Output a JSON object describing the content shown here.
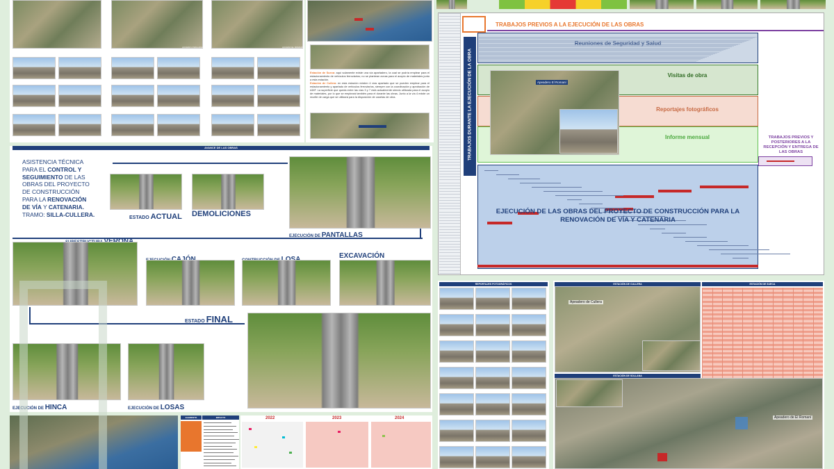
{
  "colors": {
    "navy": "#1f3f7a",
    "orange": "#e8762d",
    "red": "#c62828",
    "green_band": "#dfeedd",
    "salmon": "#f4b6a8",
    "violet": "#7b3fa0"
  },
  "sketch": {
    "title_bar": "AVANCE DE LAS OBRAS",
    "intro": {
      "line1": "ASISTENCIA TÉCNICA",
      "line2a": "PARA EL ",
      "line2b": "CONTROL Y",
      "line3": "SEGUIMIENTO",
      "line3b": " DE LAS",
      "line4": "OBRAS DEL PROYECTO",
      "line5": "DE CONSTRUCCIÓN",
      "line6a": "PARA LA ",
      "line6b": "RENOVACIÓN",
      "line7a": "DE VÍA",
      "line7b": " Y ",
      "line7c": "CATENARIA.",
      "line8a": "TRAMO: ",
      "line8b": "SILLA-CULLERA."
    },
    "labels": {
      "estado_small": "ESTADO ",
      "estado_big": "ACTUAL",
      "demoliciones": "DEMOLICIONES",
      "pantallas_small": "EJECUCIÓN DE ",
      "pantallas_big": "PANTALLAS",
      "verona_small": "SUBESTRUCTURA ",
      "verona_big": "VERONA",
      "cajon_small": "EJECUCIÓN ",
      "cajon_big": "CAJÓN",
      "losa_small": "CONTRUCCIÓN DE ",
      "losa_big": "LOSA",
      "excavacion": "EXCAVACIÓN",
      "final_small": "ESTADO ",
      "final_big": "FINAL",
      "hinca_small": "EJECUCIÓN DE ",
      "hinca_big": "HINCA",
      "losas_small": "EJECUCIÓN DE ",
      "losas_big": "LOSAS"
    }
  },
  "gantt": {
    "header": "TRABAJOS PREVIOS A LA EJECUCIÓN DE LAS OBRAS",
    "vertical_label": "TRABAJOS DURANTE LA EJECUCIÓN DE LA OBRA",
    "bands": {
      "seguridad": "Reuniones de Seguridad y Salud",
      "visitas": "Visitas de obra",
      "reportajes": "Reportajes fotográficos",
      "informe": "Informe mensual"
    },
    "side_label": "TRABAJOS PREVIOS Y POSTERIORES A LA RECEPCIÓN Y ENTREGA DE LAS OBRAS",
    "execution": "EJECUCIÓN DE LAS OBRAS DEL PROYECTO DE CONSTRUCCIÓN PARA LA RENOVACIÓN DE VÍA Y CATENARIA",
    "inset_caption": "Apeadero El Romaní"
  },
  "station_text": {
    "p1a": "Estación de Sueca",
    "p1b": ": aquí solamente existe una vía apartadero, la cual se podría emplear para el estacionamiento de vehículos ferroviarios; no se plantean zonas para el acopio de materiales junto a esta estación.",
    "p2a": "Estación de Cullera",
    "p2b": ": en esta estación existen 4 vías apartado que se pueden emplear para el estacionamiento y apartado de vehículos ferroviarios, siempre con la coordinación y aprobación de ADIF. La superficie que queda entre las vías 3 y 7 está actualmente siendo utilizada para el acopio de materiales, por lo que se empleará también para el durante las obras. Junto a la vía 4 existe un muelle de carga que se utilizará para la disposición de casetas de obra."
  },
  "reportaje": {
    "title": "REPORTAJES FOTOGRÁFICOS"
  },
  "estaciones": {
    "cullera": "ESTACIÓN DE CULLERA",
    "sueca": "ESTACIÓN DE SUECA",
    "sollana": "ESTACIÓN DE SOLLANA",
    "apeadero_cullera": "Apeadero de Cullera",
    "apeadero_romani": "Apeadero de El Romaní"
  },
  "impacto": {
    "col1": "ELEMENTO",
    "col2": "IMPACTO"
  },
  "calendar": {
    "years": [
      "2022",
      "2023",
      "2024"
    ]
  },
  "photo_captions": {
    "acceso_sollana": "ACCESO A SOLLANA",
    "acceso_romani": "ACCESO EL ROMANÍ",
    "estacion_sueca": "Estación de Sueca",
    "estacion_cullera": "Estación de Cullera"
  }
}
